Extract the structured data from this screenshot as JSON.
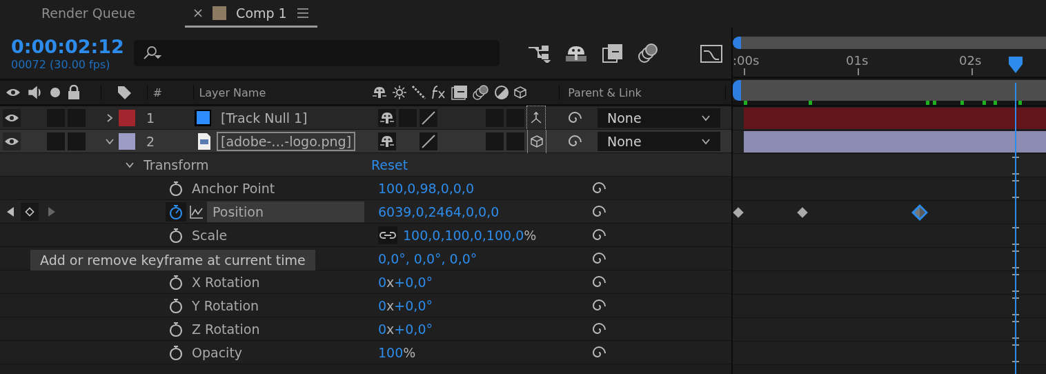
{
  "tabs": [
    {
      "label": "Render Queue",
      "selected": false
    },
    {
      "label": "Comp 1",
      "selected": true,
      "color": "#8c7b62"
    }
  ],
  "timecode": "0:00:02:12",
  "frame_info": "00072 (30.00 fps)",
  "columns": {
    "number": "#",
    "layer_name": "Layer Name",
    "parent": "Parent & Link"
  },
  "layers": [
    {
      "number": "1",
      "name": "[Track Null 1]",
      "kind": "null",
      "color": "#a3252d",
      "expanded": false,
      "selected": false,
      "parent": "None"
    },
    {
      "number": "2",
      "name": "[adobe-…-logo.png]",
      "kind": "image",
      "color": "#9c9cc6",
      "expanded": true,
      "selected": true,
      "parent": "None"
    }
  ],
  "transform": {
    "label": "Transform",
    "action": "Reset",
    "expanded": true
  },
  "properties": [
    {
      "label": "Anchor Point",
      "animated": false,
      "selected": false,
      "parts": [
        {
          "text": "100,0,98,0,0,0",
          "kind": "number"
        }
      ]
    },
    {
      "label": "Position",
      "animated": true,
      "selected": true,
      "parts": [
        {
          "text": "6039,0,2464,0,0,0",
          "kind": "number"
        }
      ],
      "keyframes": [
        {
          "selected": false
        },
        {
          "selected": false
        },
        {
          "selected": true
        }
      ]
    },
    {
      "label": "Scale",
      "animated": false,
      "selected": false,
      "linked": true,
      "parts": [
        {
          "text": "100,0,100,0,100,0",
          "kind": "number"
        },
        {
          "text": "%",
          "kind": "unit"
        }
      ]
    },
    {
      "selected": false,
      "parts": [
        {
          "text": "0,0°, 0,0°, 0,0°",
          "kind": "number"
        }
      ]
    },
    {
      "label": "X Rotation",
      "animated": false,
      "selected": false,
      "parts": [
        {
          "text": "0",
          "kind": "number"
        },
        {
          "text": "x",
          "kind": "unit"
        },
        {
          "text": "+0,0°",
          "kind": "number"
        }
      ]
    },
    {
      "label": "Y Rotation",
      "animated": false,
      "selected": false,
      "parts": [
        {
          "text": "0",
          "kind": "number"
        },
        {
          "text": "x",
          "kind": "unit"
        },
        {
          "text": "+0,0°",
          "kind": "number"
        }
      ]
    },
    {
      "label": "Z Rotation",
      "animated": false,
      "selected": false,
      "parts": [
        {
          "text": "0",
          "kind": "number"
        },
        {
          "text": "x",
          "kind": "unit"
        },
        {
          "text": "+0,0°",
          "kind": "number"
        }
      ]
    },
    {
      "label": "Opacity",
      "animated": false,
      "selected": false,
      "parts": [
        {
          "text": "100",
          "kind": "number"
        },
        {
          "text": "%",
          "kind": "unit"
        }
      ]
    }
  ],
  "tooltip": "Add or remove keyframe at current time",
  "ruler": [
    ":00s",
    "01s",
    "02s"
  ]
}
